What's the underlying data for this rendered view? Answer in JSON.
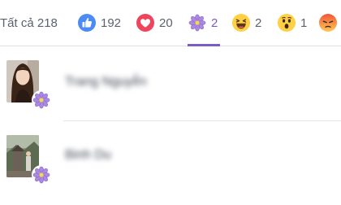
{
  "tabs": [
    {
      "label": "Tất cả 218",
      "icon": "",
      "active": false
    },
    {
      "label": "192",
      "icon": "like-icon",
      "active": false
    },
    {
      "label": "20",
      "icon": "love-icon",
      "active": false
    },
    {
      "label": "2",
      "icon": "flower-icon",
      "active": true
    },
    {
      "label": "2",
      "icon": "haha-icon",
      "active": false
    },
    {
      "label": "1",
      "icon": "wow-icon",
      "active": false
    },
    {
      "label": "",
      "icon": "angry-icon",
      "active": false
    }
  ],
  "people": [
    {
      "name": "Trang Nguyễn",
      "reaction_icon": "flower-icon"
    },
    {
      "name": "Binh Du",
      "reaction_icon": "flower-icon"
    }
  ],
  "colors": {
    "accent": "#7b5bc4",
    "like": "#4c8bf5",
    "love": "#f0445e",
    "haha_wow": "#ffd044",
    "angry": "#f26a3a",
    "flower": "#a98ae0"
  }
}
